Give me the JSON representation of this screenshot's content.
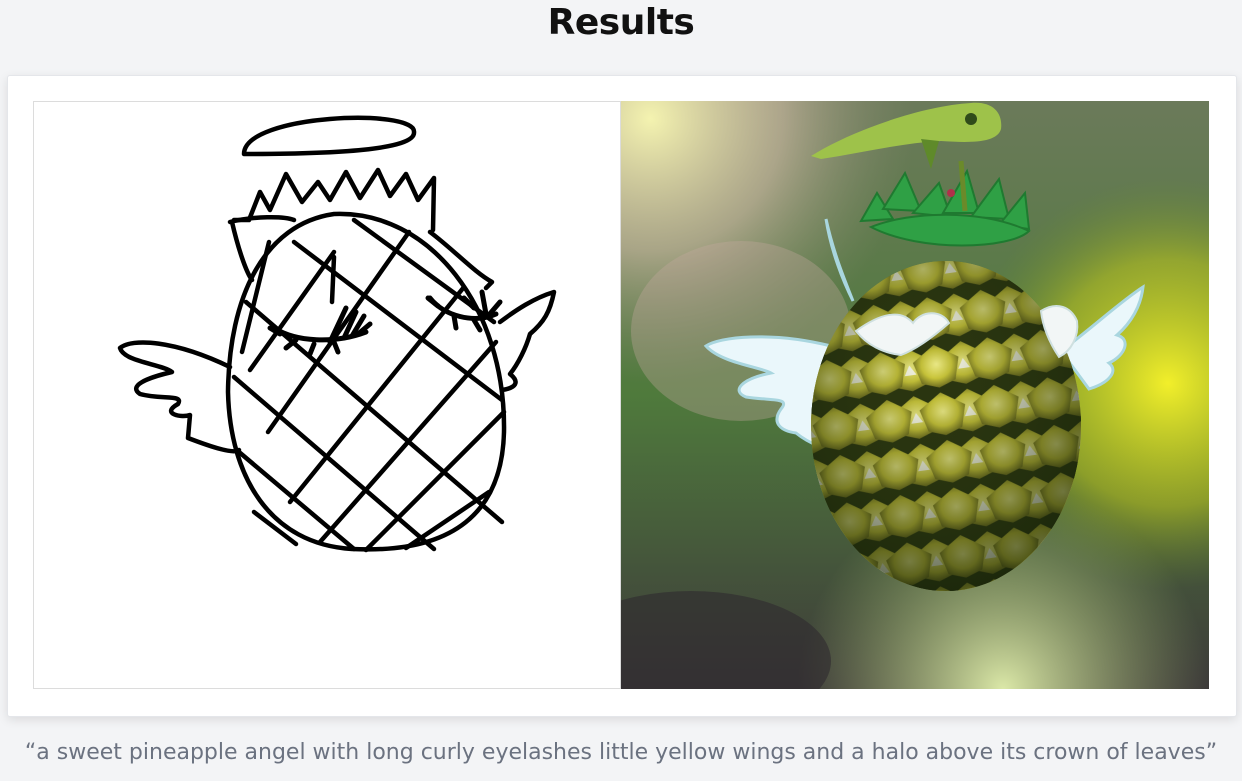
{
  "page": {
    "title": "Results"
  },
  "result": {
    "caption": "“a sweet pineapple angel with long curly eyelashes little yellow wings and a halo above its crown of leaves”"
  },
  "colors": {
    "background": "#f3f4f6",
    "card": "#ffffff",
    "title_text": "#111111",
    "caption_text": "#6b7280"
  }
}
